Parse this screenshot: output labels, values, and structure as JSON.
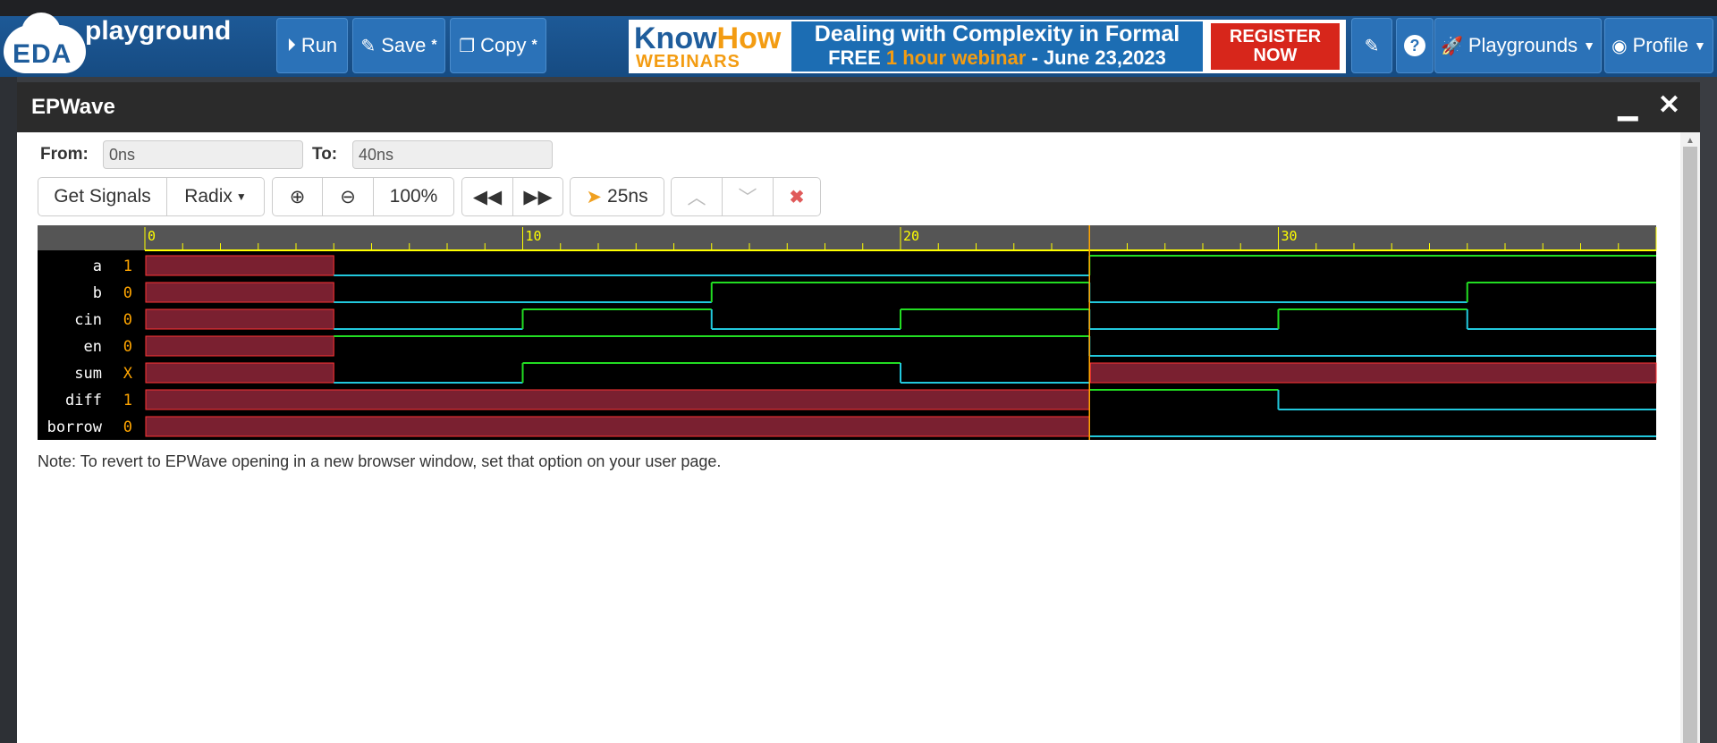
{
  "nav": {
    "brand": "playground",
    "logo_text": "EDA",
    "run_label": "Run",
    "save_label": "Save",
    "copy_label": "Copy",
    "unsaved_mark": "*",
    "playgrounds_label": "Playgrounds",
    "profile_label": "Profile"
  },
  "banner": {
    "brand_know": "Know",
    "brand_how": "How",
    "brand_sub": "WEBINARS",
    "line1": "Dealing with Complexity in Formal",
    "line2_a": "FREE ",
    "line2_b": "1 hour webinar",
    "line2_c": " - June 23,2023",
    "register_1": "REGISTER",
    "register_2": "NOW"
  },
  "modal": {
    "title": "EPWave",
    "from_label": "From:",
    "from_value": "0ns",
    "to_label": "To:",
    "to_value": "40ns",
    "toolbar": {
      "get_signals": "Get Signals",
      "radix": "Radix",
      "zoom": "100%",
      "cursor": "25ns"
    },
    "note": "Note: To revert to EPWave opening in a new browser window, set that option on your user page."
  },
  "colors": {
    "high": "#22dd22",
    "low": "#22c8dd",
    "unknown_fill": "#7a2030",
    "unknown_line": "#ff3333",
    "value_text": "#ffa500",
    "ruler_bg": "#555555",
    "ruler_line": "#ffff00",
    "cursor": "#ffa500"
  },
  "waveform": {
    "ruler_labels": [
      {
        "t": 0,
        "label": "0"
      },
      {
        "t": 10,
        "label": "10"
      },
      {
        "t": 20,
        "label": "20"
      },
      {
        "t": 30,
        "label": "30"
      }
    ],
    "t_end": 40,
    "cursor_t": 25,
    "signals": [
      {
        "name": "a",
        "value": "1",
        "segments": [
          [
            0,
            5,
            "x"
          ],
          [
            5,
            25,
            "0"
          ],
          [
            25,
            40,
            "1"
          ]
        ]
      },
      {
        "name": "b",
        "value": "0",
        "segments": [
          [
            0,
            5,
            "x"
          ],
          [
            5,
            15,
            "0"
          ],
          [
            15,
            25,
            "1"
          ],
          [
            25,
            35,
            "0"
          ],
          [
            35,
            40,
            "1"
          ]
        ]
      },
      {
        "name": "cin",
        "value": "0",
        "segments": [
          [
            0,
            5,
            "x"
          ],
          [
            5,
            10,
            "0"
          ],
          [
            10,
            15,
            "1"
          ],
          [
            15,
            20,
            "0"
          ],
          [
            20,
            25,
            "1"
          ],
          [
            25,
            30,
            "0"
          ],
          [
            30,
            35,
            "1"
          ],
          [
            35,
            40,
            "0"
          ]
        ]
      },
      {
        "name": "en",
        "value": "0",
        "segments": [
          [
            0,
            5,
            "x"
          ],
          [
            5,
            25,
            "1"
          ],
          [
            25,
            40,
            "0"
          ]
        ]
      },
      {
        "name": "sum",
        "value": "X",
        "segments": [
          [
            0,
            5,
            "x"
          ],
          [
            5,
            10,
            "0"
          ],
          [
            10,
            20,
            "1"
          ],
          [
            20,
            25,
            "0"
          ],
          [
            25,
            40,
            "x"
          ]
        ]
      },
      {
        "name": "diff",
        "value": "1",
        "segments": [
          [
            0,
            25,
            "x"
          ],
          [
            25,
            30,
            "1"
          ],
          [
            30,
            40,
            "0"
          ]
        ]
      },
      {
        "name": "borrow",
        "value": "0",
        "segments": [
          [
            0,
            25,
            "x"
          ],
          [
            25,
            40,
            "0"
          ]
        ]
      }
    ]
  }
}
